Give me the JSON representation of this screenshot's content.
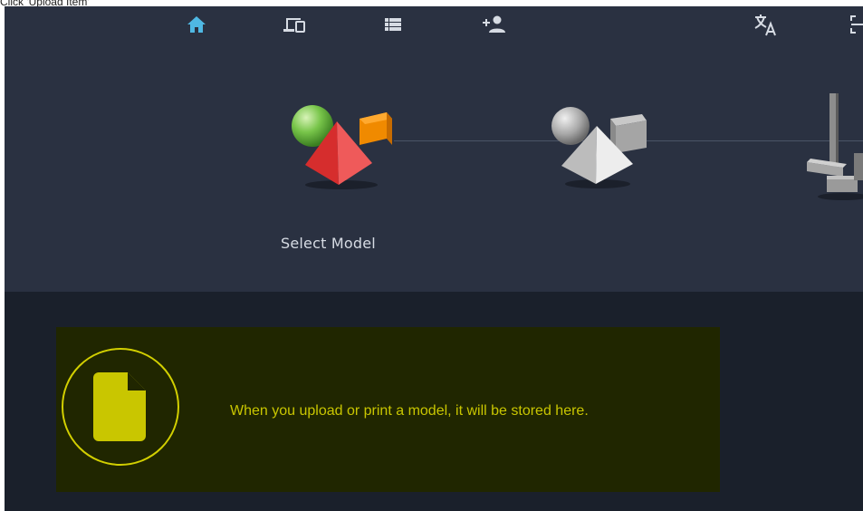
{
  "caption": "Click 'Upload Item'",
  "nav": {
    "items": [
      {
        "icon": "home-icon",
        "color": "#4fb8e3"
      },
      {
        "icon": "devices-icon",
        "color": "#d6dbe3"
      },
      {
        "icon": "list-icon",
        "color": "#d6dbe3"
      },
      {
        "icon": "add-user-icon",
        "color": "#d6dbe3"
      },
      {
        "icon": "translate-icon",
        "color": "#d6dbe3"
      },
      {
        "icon": "scan-icon",
        "color": "#d6dbe3"
      }
    ]
  },
  "steps": {
    "active_label": "Select Model",
    "items": [
      {
        "icon": "colored-shapes-icon",
        "state": "active"
      },
      {
        "icon": "gray-shapes-icon",
        "state": "inactive"
      },
      {
        "icon": "printer-parts-icon",
        "state": "inactive"
      }
    ]
  },
  "empty_state": {
    "icon": "file-icon",
    "message": "When you upload or print a model, it will be stored here.",
    "accent_color": "#d2cf00"
  },
  "colors": {
    "header_bg": "#2a3141",
    "content_bg": "#1a202b",
    "panel_bg": "#202600"
  }
}
